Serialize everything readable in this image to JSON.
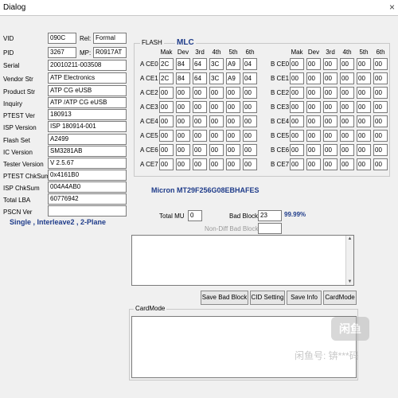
{
  "window": {
    "title": "Dialog",
    "close_glyph": "×"
  },
  "info": {
    "vid_label": "VID",
    "vid": "090C",
    "rel_label": "Rel:",
    "rel": "Formal",
    "pid_label": "PID",
    "pid": "3267",
    "mp_label": "MP:",
    "mp": "R0917AT",
    "serial_label": "Serial",
    "serial": "20010211-003508",
    "vendor_label": "Vendor Str",
    "vendor": "ATP Electronics",
    "product_label": "Product Str",
    "product": "ATP CG eUSB",
    "inquiry_label": "Inquiry",
    "inquiry": "ATP    /ATP CG eUSB",
    "ptest_label": "PTEST Ver",
    "ptest": "180913",
    "isp_label": "ISP Version",
    "isp": "ISP 180914-001",
    "flashset_label": "Flash Set",
    "flashset": "A2499",
    "ic_label": "IC Version",
    "ic": "SM3281AB",
    "tester_label": "Tester Version",
    "tester": "V 2.5.67",
    "ptestchk_label": "PTEST ChkSum",
    "ptestchk": "0x4161B0",
    "ispchk_label": "ISP ChkSum",
    "ispchk": "004A4AB0",
    "lba_label": "Total LBA",
    "lba": "60776942",
    "pscn_label": "PSCN Ver",
    "pscn": ""
  },
  "mode_text": "Single , Interleave2 , 2-Plane",
  "flash": {
    "group_label": "FLASH",
    "type_label": "MLC",
    "headers": [
      "Mak",
      "Dev",
      "3rd",
      "4th",
      "5th",
      "6th"
    ],
    "a_rows": [
      {
        "label": "A CE0",
        "cells": [
          "2C",
          "84",
          "64",
          "3C",
          "A9",
          "04"
        ]
      },
      {
        "label": "A CE1",
        "cells": [
          "2C",
          "84",
          "64",
          "3C",
          "A9",
          "04"
        ]
      },
      {
        "label": "A CE2",
        "cells": [
          "00",
          "00",
          "00",
          "00",
          "00",
          "00"
        ]
      },
      {
        "label": "A CE3",
        "cells": [
          "00",
          "00",
          "00",
          "00",
          "00",
          "00"
        ]
      },
      {
        "label": "A CE4",
        "cells": [
          "00",
          "00",
          "00",
          "00",
          "00",
          "00"
        ]
      },
      {
        "label": "A CE5",
        "cells": [
          "00",
          "00",
          "00",
          "00",
          "00",
          "00"
        ]
      },
      {
        "label": "A CE6",
        "cells": [
          "00",
          "00",
          "00",
          "00",
          "00",
          "00"
        ]
      },
      {
        "label": "A CE7",
        "cells": [
          "00",
          "00",
          "00",
          "00",
          "00",
          "00"
        ]
      }
    ],
    "b_rows": [
      {
        "label": "B CE0",
        "cells": [
          "00",
          "00",
          "00",
          "00",
          "00",
          "00"
        ]
      },
      {
        "label": "B CE1",
        "cells": [
          "00",
          "00",
          "00",
          "00",
          "00",
          "00"
        ]
      },
      {
        "label": "B CE2",
        "cells": [
          "00",
          "00",
          "00",
          "00",
          "00",
          "00"
        ]
      },
      {
        "label": "B CE3",
        "cells": [
          "00",
          "00",
          "00",
          "00",
          "00",
          "00"
        ]
      },
      {
        "label": "B CE4",
        "cells": [
          "00",
          "00",
          "00",
          "00",
          "00",
          "00"
        ]
      },
      {
        "label": "B CE5",
        "cells": [
          "00",
          "00",
          "00",
          "00",
          "00",
          "00"
        ]
      },
      {
        "label": "B CE6",
        "cells": [
          "00",
          "00",
          "00",
          "00",
          "00",
          "00"
        ]
      },
      {
        "label": "B CE7",
        "cells": [
          "00",
          "00",
          "00",
          "00",
          "00",
          "00"
        ]
      }
    ],
    "part_number": "Micron MT29F256G08EBHAFES"
  },
  "stats": {
    "total_mu_label": "Total MU",
    "total_mu": "0",
    "bad_block_label": "Bad Block",
    "bad_block": "23",
    "percent": "99.99%",
    "nondiff_label": "Non-Diff Bad Block",
    "nondiff": ""
  },
  "buttons": {
    "save_bad_block": "Save Bad Block",
    "cid_setting": "CID Setting",
    "save_info": "Save Info",
    "cardmode": "CardMode"
  },
  "cardmode_group_label": "CardMode",
  "watermark": {
    "logo": "闲鱼",
    "text": "闲鱼号: 锛***码"
  },
  "colors": {
    "accent_blue": "#1f3c8a",
    "window_bg": "#f0f0f0"
  }
}
